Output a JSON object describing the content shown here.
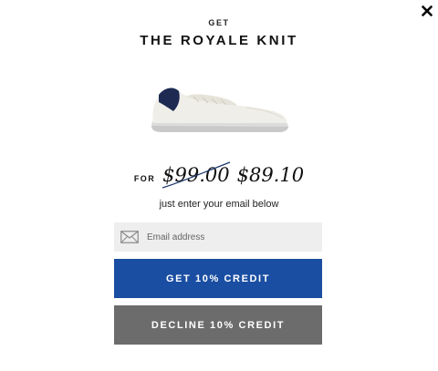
{
  "modal": {
    "eyebrow": "GET",
    "title": "THE ROYALE KNIT",
    "product_image": "sneaker-image",
    "close_icon": "close-icon"
  },
  "pricing": {
    "for_label": "FOR",
    "original_price": "$99.00",
    "sale_price": "$89.10",
    "instruction": "just enter your email below"
  },
  "email": {
    "icon": "envelope-icon",
    "placeholder": "Email address",
    "value": ""
  },
  "buttons": {
    "get_credit": "GET 10% CREDIT",
    "decline_credit": "DECLINE 10% CREDIT"
  },
  "colors": {
    "primary": "#1a4ea2",
    "secondary": "#6c6c6c",
    "input_bg": "#eeeeee",
    "strike": "#1f3a6e"
  }
}
